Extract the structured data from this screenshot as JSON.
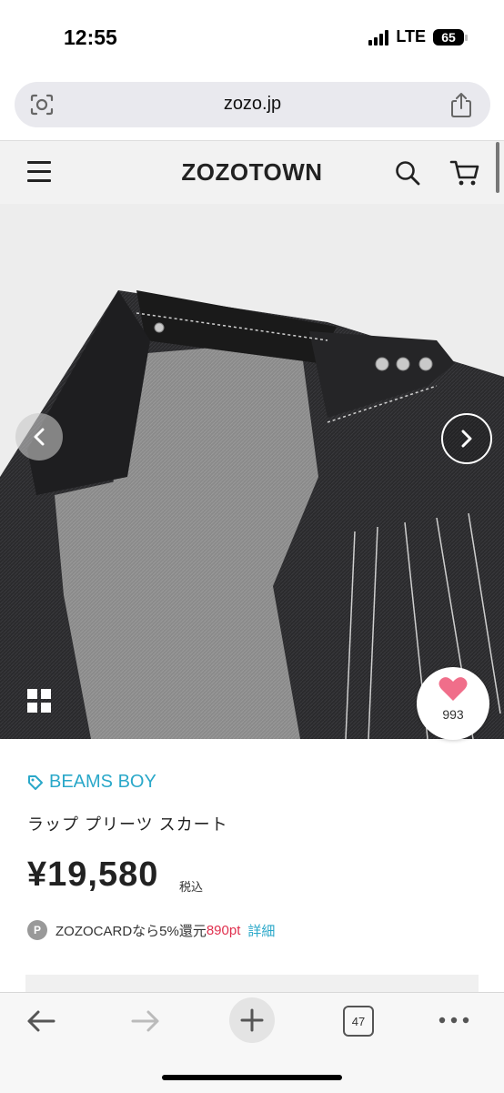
{
  "status": {
    "time": "12:55",
    "network": "LTE",
    "battery": "65"
  },
  "browser": {
    "url": "zozo.jp",
    "tab_count": "47"
  },
  "header": {
    "logo": "ZOZOTOWN"
  },
  "product": {
    "brand": "BEAMS BOY",
    "name": "ラップ プリーツ スカート",
    "price": "¥19,580",
    "tax_label": "税込",
    "favorite_count": "993",
    "point_badge": "P",
    "point_text": "ZOZOCARDなら5%還元",
    "point_value": "890pt",
    "detail_link": "詳細"
  },
  "colors": {
    "accent": "#2aa8c9",
    "heart": "#f06e8a",
    "points": "#e0304e"
  },
  "icons": [
    "camera-search-icon",
    "share-icon",
    "menu-icon",
    "search-icon",
    "cart-icon",
    "chevron-left-icon",
    "chevron-right-icon",
    "grid-icon",
    "heart-icon",
    "tag-icon",
    "back-icon",
    "forward-icon",
    "plus-icon",
    "tabs-icon",
    "more-icon"
  ]
}
